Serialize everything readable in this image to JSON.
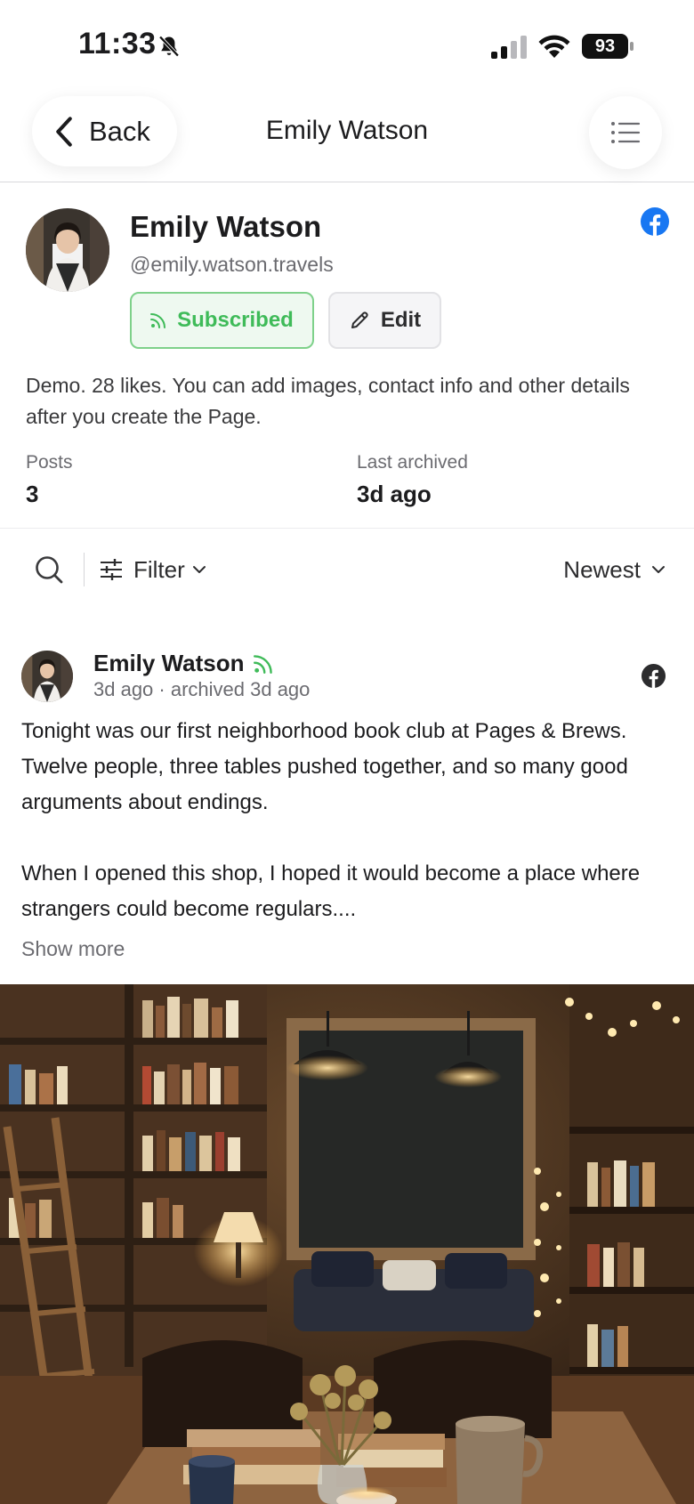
{
  "status_bar": {
    "time": "11:33",
    "battery": "93",
    "icons": [
      "bell-muted-icon",
      "cellular-signal-icon",
      "wifi-icon",
      "battery-icon"
    ]
  },
  "header": {
    "back_label": "Back",
    "title": "Emily Watson",
    "menu_icon": "list-icon"
  },
  "profile": {
    "name": "Emily Watson",
    "handle": "@emily.watson.travels",
    "platform_icon": "facebook-icon",
    "subscribed_label": "Subscribed",
    "edit_label": "Edit",
    "bio": "Demo. 28 likes. You can add images, contact info and other details after you create the Page.",
    "stats": [
      {
        "label": "Posts",
        "value": "3"
      },
      {
        "label": "Last archived",
        "value": "3d ago"
      }
    ]
  },
  "toolbar": {
    "filter_label": "Filter",
    "sort_label": "Newest"
  },
  "post": {
    "author": "Emily Watson",
    "meta": "3d ago · archived 3d ago",
    "paragraphs": [
      "Tonight was our first neighborhood book club at Pages & Brews. Twelve people, three tables pushed together, and so many good arguments about endings.",
      "When I opened this shop, I hoped it would become a place where strangers could become regulars...."
    ],
    "show_more": "Show more"
  },
  "colors": {
    "subscribed_green": "#3fbb59",
    "facebook_blue": "#1877f2",
    "muted_text": "#6b6b70"
  }
}
